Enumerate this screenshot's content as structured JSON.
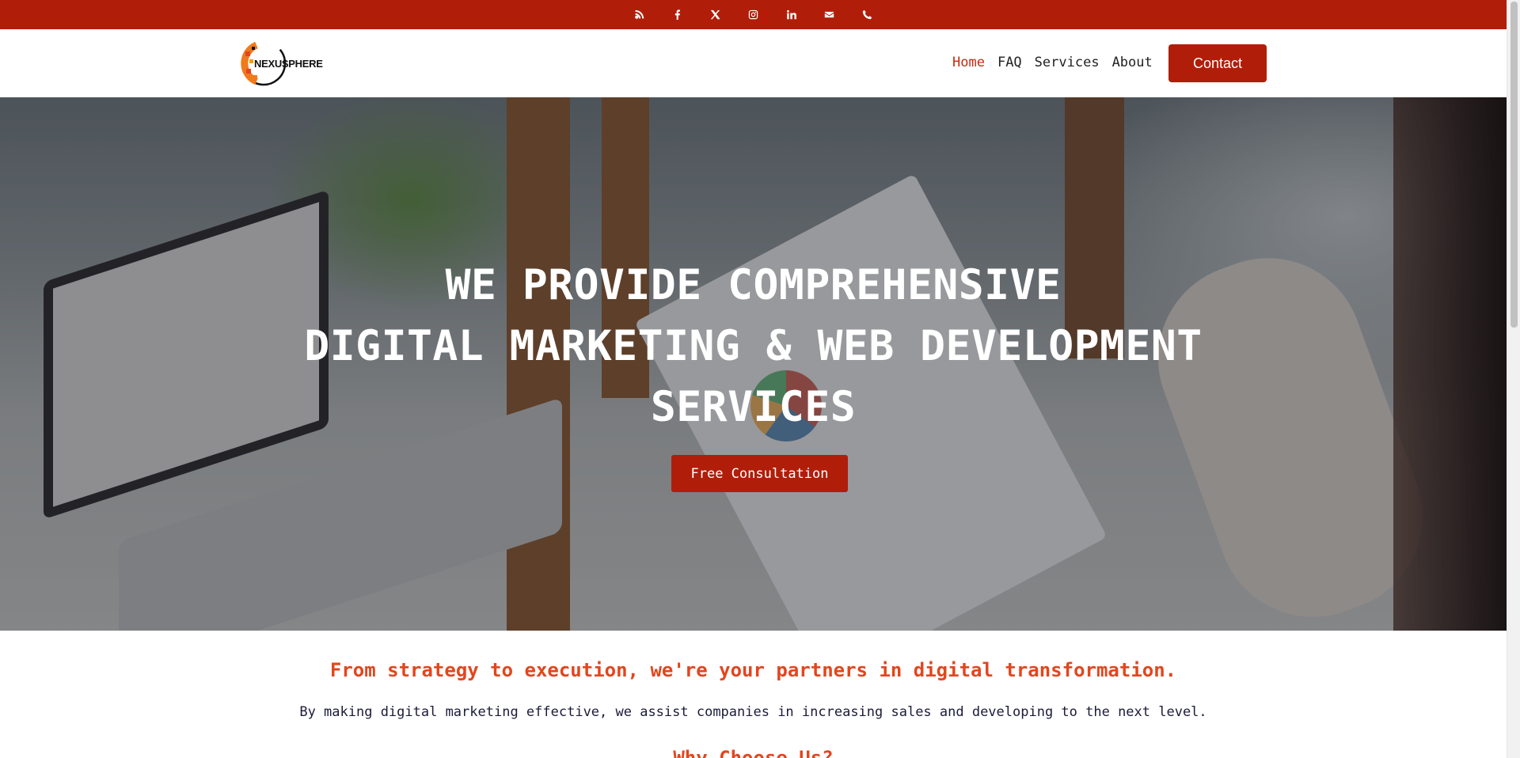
{
  "topbar": {
    "icons": [
      "blog-icon",
      "facebook-icon",
      "x-twitter-icon",
      "instagram-icon",
      "linkedin-icon",
      "email-icon",
      "phone-icon"
    ]
  },
  "brand": {
    "logo_text": "NEXUSPHERE",
    "accent": "#b01e0a",
    "highlight": "#e2461e"
  },
  "nav": {
    "items": [
      {
        "label": "Home"
      },
      {
        "label": "FAQ"
      },
      {
        "label": "Services"
      },
      {
        "label": "About"
      }
    ],
    "contact_label": "Contact"
  },
  "hero": {
    "line1": "WE PROVIDE COMPREHENSIVE",
    "line2": "DIGITAL MARKETING & WEB DEVELOPMENT",
    "line3": "SERVICES",
    "cta_label": "Free Consultation"
  },
  "intro": {
    "tagline": "From strategy to execution, we're your partners in digital transformation.",
    "text": "By making digital marketing effective, we assist companies in increasing sales and developing to the next level.",
    "next_heading": "Why Choose Us?"
  }
}
